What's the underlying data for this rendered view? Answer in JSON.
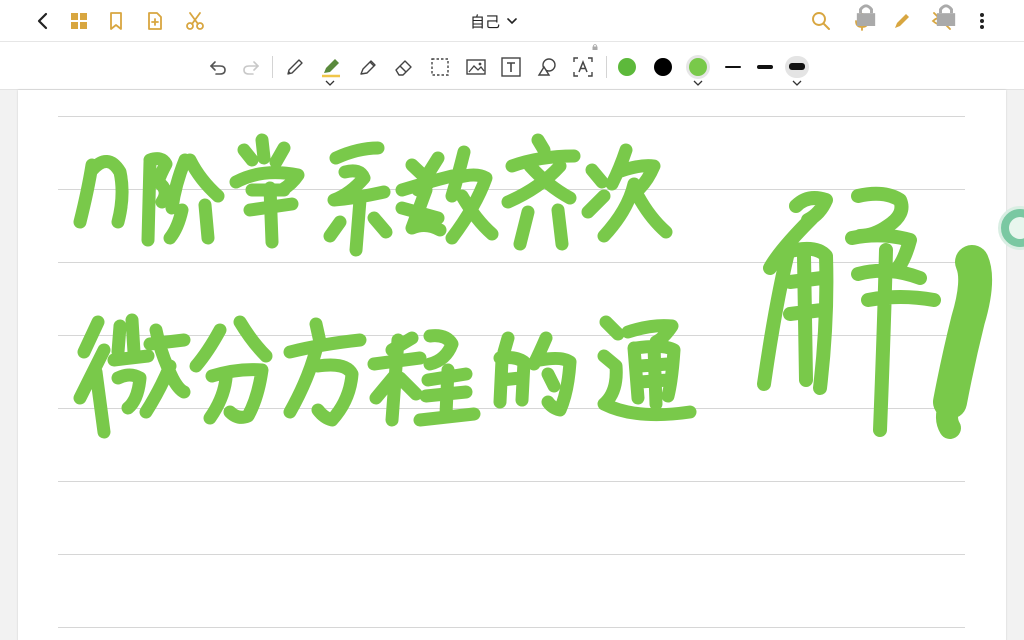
{
  "title_bar": {
    "title": "自己",
    "icons": [
      "back-icon",
      "grid-icon",
      "bookmark-icon",
      "add-page-icon",
      "scissors-icon",
      "search-icon",
      "microphone-icon",
      "pen-icon",
      "hide-icon",
      "more-icon"
    ]
  },
  "toolbar": {
    "tools": [
      "undo",
      "redo",
      "pen",
      "highlighter",
      "marker",
      "eraser",
      "lasso-select",
      "image",
      "text",
      "shapes",
      "text-recognition"
    ],
    "colors": [
      "#5db93b",
      "#000000",
      "#79c94a"
    ],
    "stroke_widths": [
      "thin",
      "medium",
      "thick"
    ],
    "selected_color": "#79c94a",
    "selected_width": "thick"
  },
  "page": {
    "ink_color": "#79c94a",
    "handwriting_line1": "n阶常系数齐次",
    "handwriting_line2": "微分方程的通",
    "handwriting_large": "解!"
  }
}
